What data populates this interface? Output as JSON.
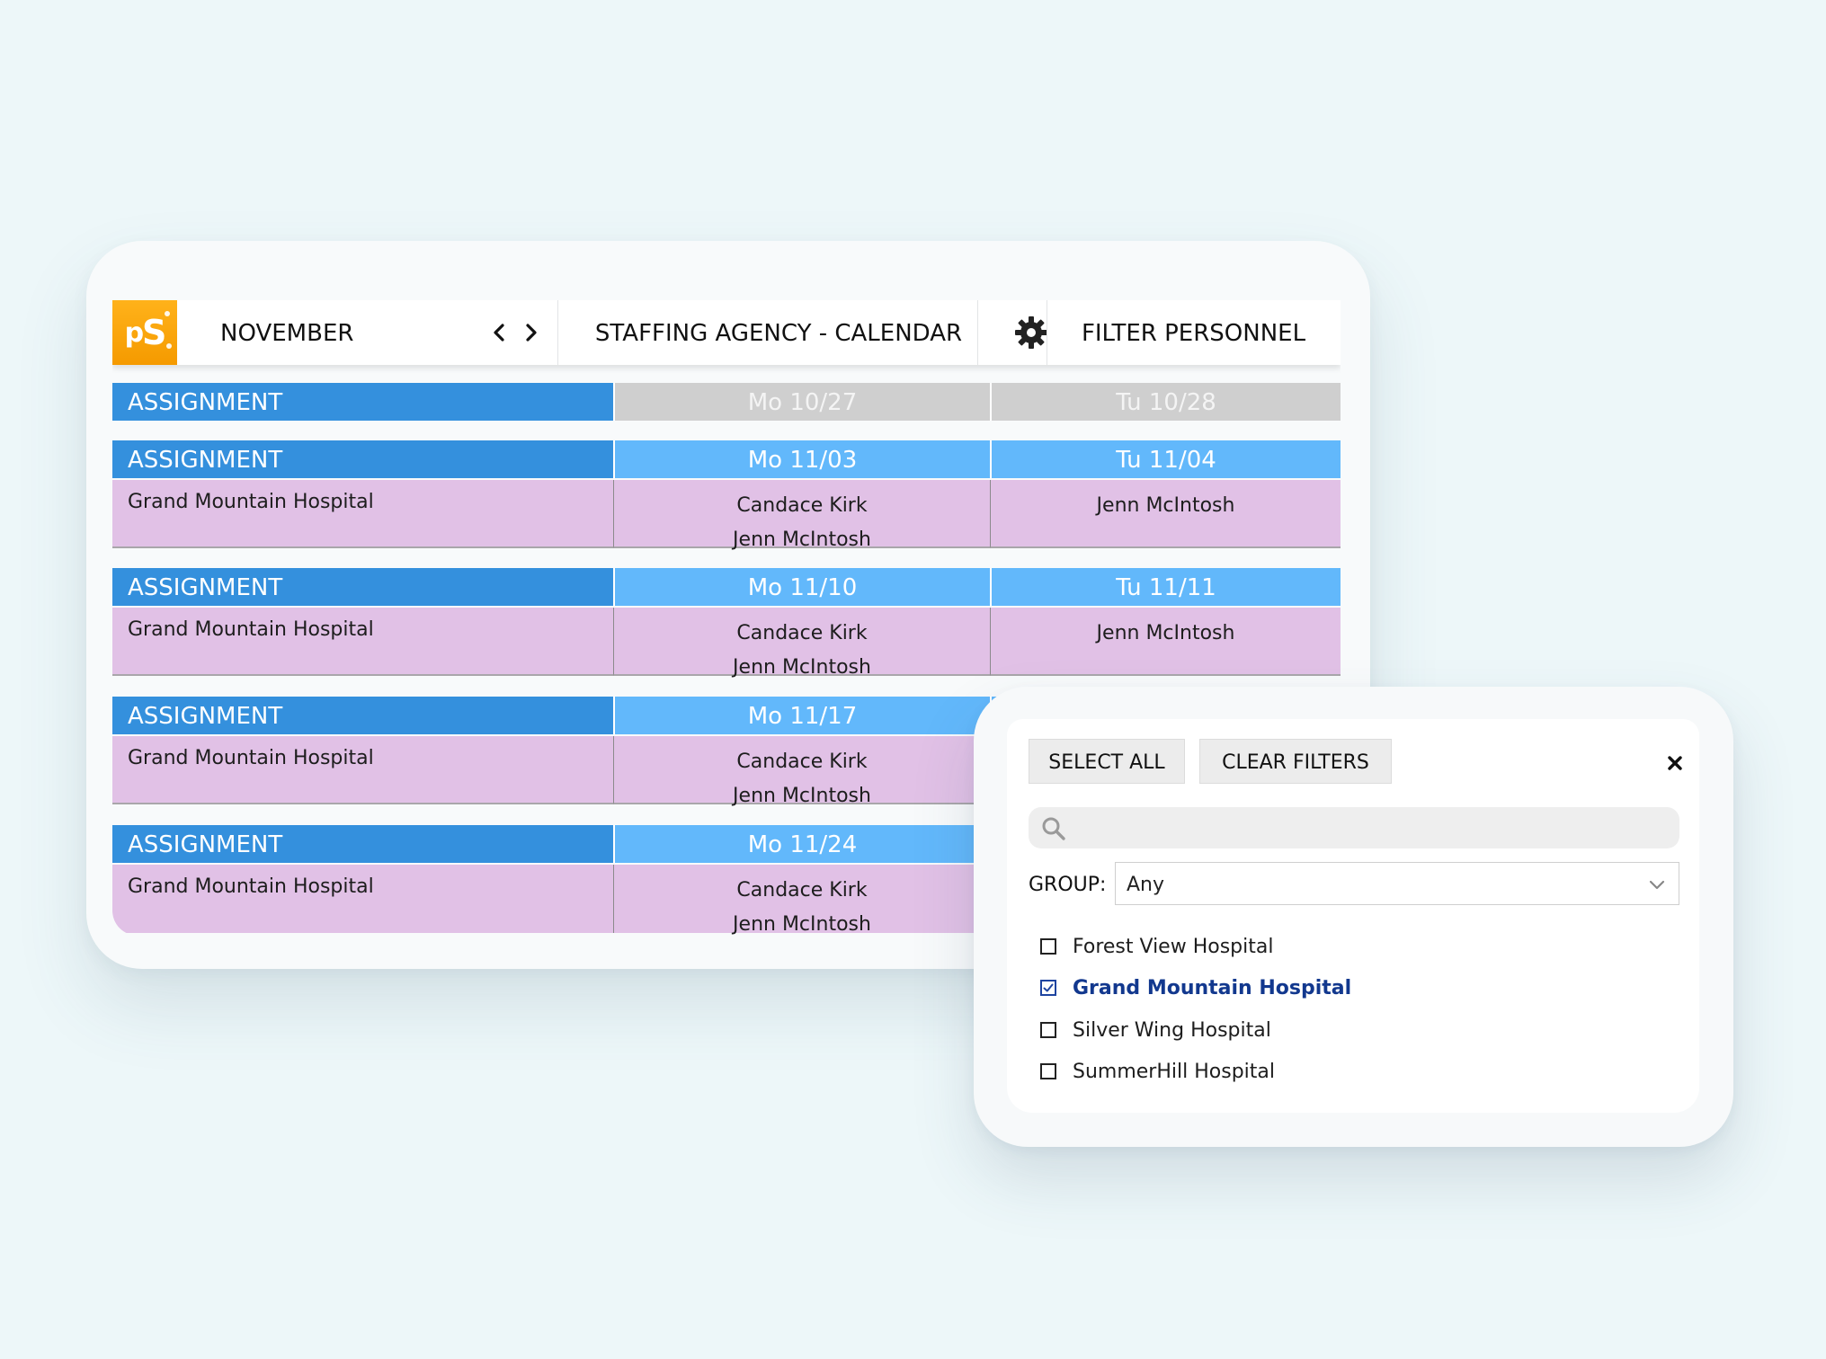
{
  "topbar": {
    "month": "NOVEMBER",
    "title": "STAFFING AGENCY - CALENDAR",
    "filter": "FILTER PERSONNEL"
  },
  "calendar": {
    "weeks": [
      {
        "label": "ASSIGNMENT",
        "day1": "Mo 10/27",
        "day2": "Tu 10/28",
        "past": true
      },
      {
        "label": "ASSIGNMENT",
        "day1": "Mo 11/03",
        "day2": "Tu 11/04",
        "hospital": "Grand Mountain Hospital",
        "day1_names": [
          "Candace Kirk",
          "Jenn McIntosh"
        ],
        "day2_names": [
          "Jenn McIntosh"
        ]
      },
      {
        "label": "ASSIGNMENT",
        "day1": "Mo 11/10",
        "day2": "Tu 11/11",
        "hospital": "Grand Mountain Hospital",
        "day1_names": [
          "Candace Kirk",
          "Jenn McIntosh"
        ],
        "day2_names": [
          "Jenn McIntosh"
        ]
      },
      {
        "label": "ASSIGNMENT",
        "day1": "Mo 11/17",
        "hospital": "Grand Mountain Hospital",
        "day1_names": [
          "Candace Kirk",
          "Jenn McIntosh"
        ]
      },
      {
        "label": "ASSIGNMENT",
        "day1": "Mo 11/24",
        "hospital": "Grand Mountain Hospital",
        "day1_names": [
          "Candace Kirk",
          "Jenn McIntosh"
        ]
      }
    ]
  },
  "filter_panel": {
    "select_all": "SELECT ALL",
    "clear_filters": "CLEAR FILTERS",
    "search_placeholder": "",
    "group_label": "GROUP:",
    "group_value": "Any",
    "options": [
      {
        "label": "Forest View Hospital",
        "checked": false
      },
      {
        "label": "Grand Mountain Hospital",
        "checked": true
      },
      {
        "label": "Silver Wing Hospital",
        "checked": false
      },
      {
        "label": "SummerHill Hospital",
        "checked": false
      }
    ]
  },
  "colors": {
    "background": "#edf7f9",
    "logo": "#f7a30a",
    "assignment_header": "#3490dd",
    "day_header": "#62b8fb",
    "past_day_header": "#cfcfcf",
    "assignment_row": "#e1c1e6",
    "checked_text": "#12388e"
  },
  "icons": {
    "logo": "ps-logo",
    "prev": "chevron-left-icon",
    "next": "chevron-right-icon",
    "settings": "gear-icon",
    "close": "close-icon",
    "search": "search-icon",
    "dropdown": "chevron-down-icon"
  }
}
